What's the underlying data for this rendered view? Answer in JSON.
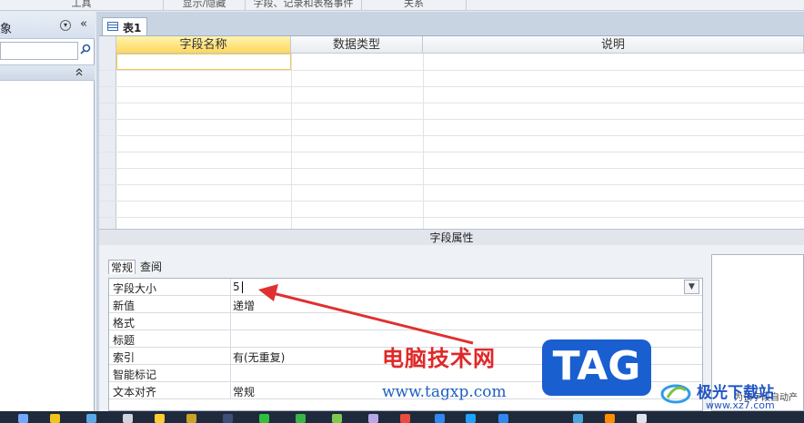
{
  "ribbon": {
    "groups": [
      "工具",
      "显示/隐藏",
      "字段、记录和表格事件",
      "关系"
    ]
  },
  "nav": {
    "title": "象",
    "dropdown_icon": "chevron-down-circle-icon",
    "collapse_icon": "«",
    "search_placeholder": "",
    "group_toggle": "⌃"
  },
  "document": {
    "tab_label": "表1",
    "columns": [
      "字段名称",
      "数据类型",
      "说明"
    ]
  },
  "properties": {
    "section_title": "字段属性",
    "tabs": [
      "常规",
      "查阅"
    ],
    "rows": [
      {
        "label": "字段大小",
        "value": "5"
      },
      {
        "label": "新值",
        "value": "递增"
      },
      {
        "label": "格式",
        "value": ""
      },
      {
        "label": "标题",
        "value": ""
      },
      {
        "label": "索引",
        "value": "有(无重复)"
      },
      {
        "label": "智能标记",
        "value": ""
      },
      {
        "label": "文本对齐",
        "value": "常规"
      }
    ],
    "help_text": "为该字段自动产"
  },
  "watermark": {
    "title": "电脑技术网",
    "url": "www.tagxp.com",
    "tag": "TAG",
    "site2_name": "极光下载站",
    "site2_url": "www.xz7.com"
  },
  "colors": {
    "accent": "#ffd75e",
    "arrow": "#e03030",
    "tag_blue": "#1a5fd0"
  }
}
